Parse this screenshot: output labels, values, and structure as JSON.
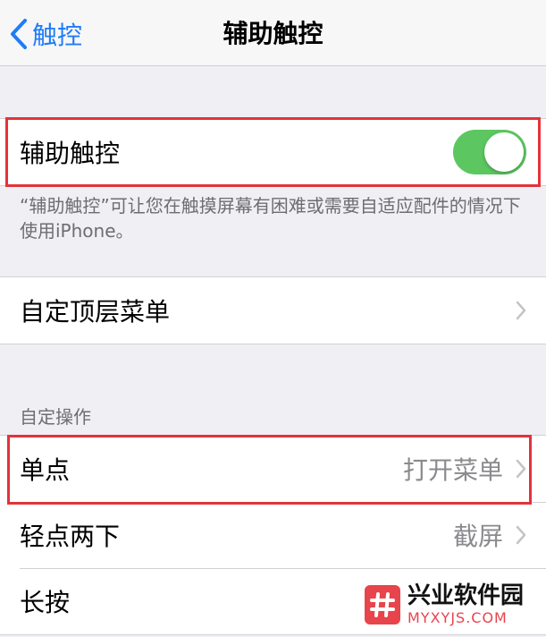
{
  "nav": {
    "back_label": "触控",
    "title": "辅助触控"
  },
  "toggle_group": {
    "label": "辅助触控",
    "toggle_state": "on",
    "toggle_color": "#5cc761"
  },
  "footnote": "“辅助触控”可让您在触摸屏幕有困难或需要自适应配件的情况下使用iPhone。",
  "menu_group": {
    "label": "自定顶层菜单"
  },
  "custom_actions": {
    "header": "自定操作",
    "rows": [
      {
        "label": "单点",
        "value": "打开菜单"
      },
      {
        "label": "轻点两下",
        "value": "截屏"
      },
      {
        "label": "长按",
        "value": ""
      }
    ]
  },
  "watermark": {
    "name": "兴业软件园",
    "url": "MYXYJS.COM"
  },
  "colors": {
    "accent": "#1e7cf7",
    "highlight": "#e2333a",
    "background": "#efeff4"
  }
}
